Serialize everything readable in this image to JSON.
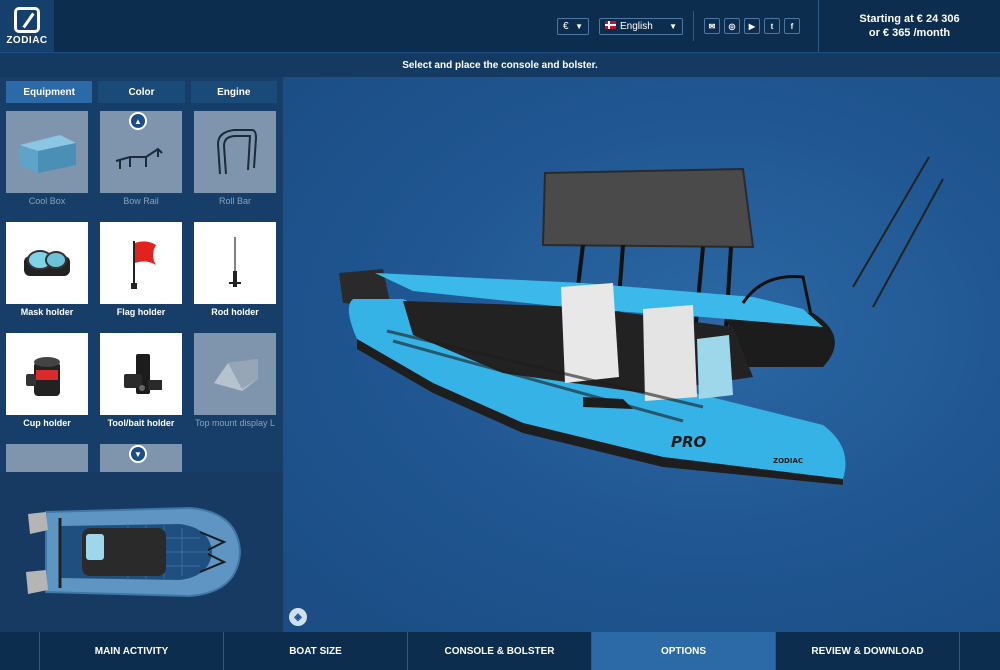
{
  "brand": {
    "logo_text": "ZODIAC"
  },
  "header": {
    "currency": "€",
    "language": "English",
    "social_icons": [
      "mail-icon",
      "instagram-icon",
      "youtube-icon",
      "twitter-icon",
      "facebook-icon"
    ],
    "price_line1": "Starting at € 24 306",
    "price_line2": "or € 365 /month"
  },
  "instruction": "Select and place the console and bolster.",
  "tabs": [
    "Equipment",
    "Color",
    "Engine"
  ],
  "active_tab": "Equipment",
  "equipment": {
    "items": [
      {
        "label": "Cool Box",
        "enabled": false,
        "icon": "cool-box-icon"
      },
      {
        "label": "Bow Rail",
        "enabled": false,
        "icon": "bow-rail-icon"
      },
      {
        "label": "Roll Bar",
        "enabled": false,
        "icon": "roll-bar-icon"
      },
      {
        "label": "Mask holder",
        "enabled": true,
        "icon": "mask-holder-icon"
      },
      {
        "label": "Flag holder",
        "enabled": true,
        "icon": "flag-holder-icon"
      },
      {
        "label": "Rod holder",
        "enabled": true,
        "icon": "rod-holder-icon"
      },
      {
        "label": "Cup holder",
        "enabled": true,
        "icon": "cup-holder-icon"
      },
      {
        "label": "Tool/bait holder",
        "enabled": true,
        "icon": "tool-bait-holder-icon"
      },
      {
        "label": "Top mount display L",
        "enabled": false,
        "icon": "top-mount-display-icon"
      }
    ]
  },
  "viewport": {
    "hull_text": "PRO",
    "hull_brand": "ZODIAC"
  },
  "bottom_nav": [
    "MAIN ACTIVITY",
    "BOAT SIZE",
    "CONSOLE & BOLSTER",
    "OPTIONS",
    "REVIEW & DOWNLOAD"
  ],
  "active_step": "OPTIONS",
  "colors": {
    "accent": "#2b6aa6",
    "header": "#0d2d4f",
    "hull": "#35b3e6"
  }
}
